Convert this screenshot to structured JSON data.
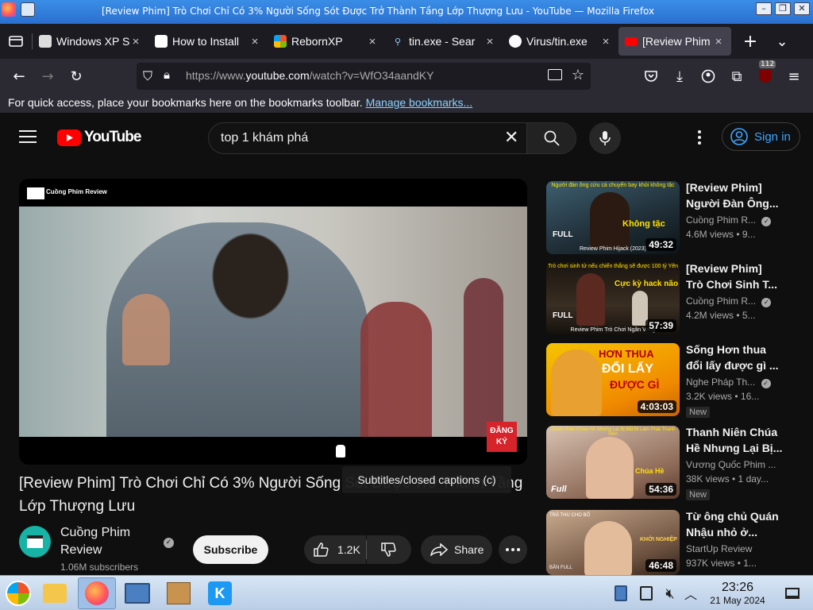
{
  "window": {
    "title": "[Review Phim] Trò Chơi Chỉ Có 3% Người Sống Sót Được Trở Thành Tầng Lớp Thượng Lưu - YouTube — Mozilla Firefox"
  },
  "tabs": [
    {
      "label": "Windows XP S",
      "icon": "windowsxp-icon"
    },
    {
      "label": "How to Install",
      "icon": "page-icon"
    },
    {
      "label": "RebornXP",
      "icon": "windows-flag-icon"
    },
    {
      "label": "tin.exe - Sear",
      "icon": "search-icon"
    },
    {
      "label": "Virus/tin.exe",
      "icon": "github-icon"
    },
    {
      "label": "[Review Phim",
      "icon": "youtube-icon",
      "active": true
    }
  ],
  "navbar": {
    "url_prefix": "https://www.",
    "url_domain": "youtube.com",
    "url_path": "/watch?v=WfO34aandKY",
    "extension_badge": "112"
  },
  "bookmarks_bar": {
    "text": "For quick access, place your bookmarks here on the bookmarks toolbar.",
    "link": "Manage bookmarks..."
  },
  "youtube": {
    "logo_text": "YouTube",
    "search_query": "top 1 khám phá",
    "sign_in": "Sign in",
    "player": {
      "watermark": "Cuồng Phim Review",
      "corner_badge_line1": "ĐĂNG",
      "corner_badge_line2": "KÝ"
    },
    "tooltip": "Subtitles/closed captions (c)",
    "video_title": "[Review Phim] Trò Chơi Chỉ Có 3% Người Sống Sót Được Trở Thành Tầng Lớp Thượng Lưu",
    "channel": {
      "name_line1": "Cuồng Phim",
      "name_line2": "Review",
      "subscribers": "1.06M subscribers"
    },
    "subscribe_label": "Subscribe",
    "likes": "1.2K",
    "share_label": "Share"
  },
  "recommendations": [
    {
      "title_line1": "[Review Phim]",
      "title_line2": "Người Đàn Ông...",
      "channel": "Cuồng Phim R...",
      "verified": true,
      "meta": "4.6M views  • 9...",
      "duration": "49:32",
      "badge": "",
      "thumb_top_text": "Người đàn ông cứu cả chuyến bay khỏi không tặc",
      "thumb_main_text": "Không tặc",
      "thumb_bottom_text": "Review Phim Hijack (2023)",
      "thumb_full": "FULL"
    },
    {
      "title_line1": "[Review Phim]",
      "title_line2": "Trò Chơi Sinh T...",
      "channel": "Cuồng Phim R...",
      "verified": true,
      "meta": "4.2M views  • 5...",
      "duration": "57:39",
      "badge": "",
      "thumb_top_text": "Trò chơi sinh tử nếu chiến thắng sẽ được 100 tỷ Yên",
      "thumb_main_text": "Cực kỳ hack não",
      "thumb_bottom_text": "Review Phim Trò Chơi Ngân Vàng",
      "thumb_full": "FULL"
    },
    {
      "title_line1": "Sống Hơn thua",
      "title_line2": "đổi lấy được gì ...",
      "channel": "Nghe Pháp Th...",
      "verified": true,
      "meta": "3.2K views  • 16...",
      "duration": "4:03:03",
      "badge": "New",
      "thumb_top_text": "HƠN THUA",
      "thumb_main_text": "ĐỔI LẤY",
      "thumb_bottom_text": "ĐƯỢC GÌ",
      "thumb_full": ""
    },
    {
      "title_line1": "Thanh Niên Chúa",
      "title_line2": "Hề Nhưng Lại Bị...",
      "channel": "Vương Quốc Phim ...",
      "verified": false,
      "meta": "38K views  • 1 day...",
      "duration": "54:36",
      "badge": "New",
      "thumb_top_text": "Thanh Niên Chúa Hề Nhưng Lại Bị Bắt Đi Làm Phát Thanh Viên",
      "thumb_main_text": "Chúa Hề",
      "thumb_bottom_text": "",
      "thumb_full": "Full"
    },
    {
      "title_line1": "Từ ông chủ Quán",
      "title_line2": "Nhậu nhỏ ở...",
      "channel": "StartUp Review",
      "verified": false,
      "meta": "937K views  • 1...",
      "duration": "46:48",
      "badge": "",
      "thumb_top_text": "TRẢ THÙ CHO BỐ",
      "thumb_main_text": "KHỞI NGHIỆP",
      "thumb_bottom_text": "BẢN FULL",
      "thumb_full": ""
    }
  ],
  "taskbar": {
    "time": "23:26",
    "date": "21 May 2024"
  }
}
